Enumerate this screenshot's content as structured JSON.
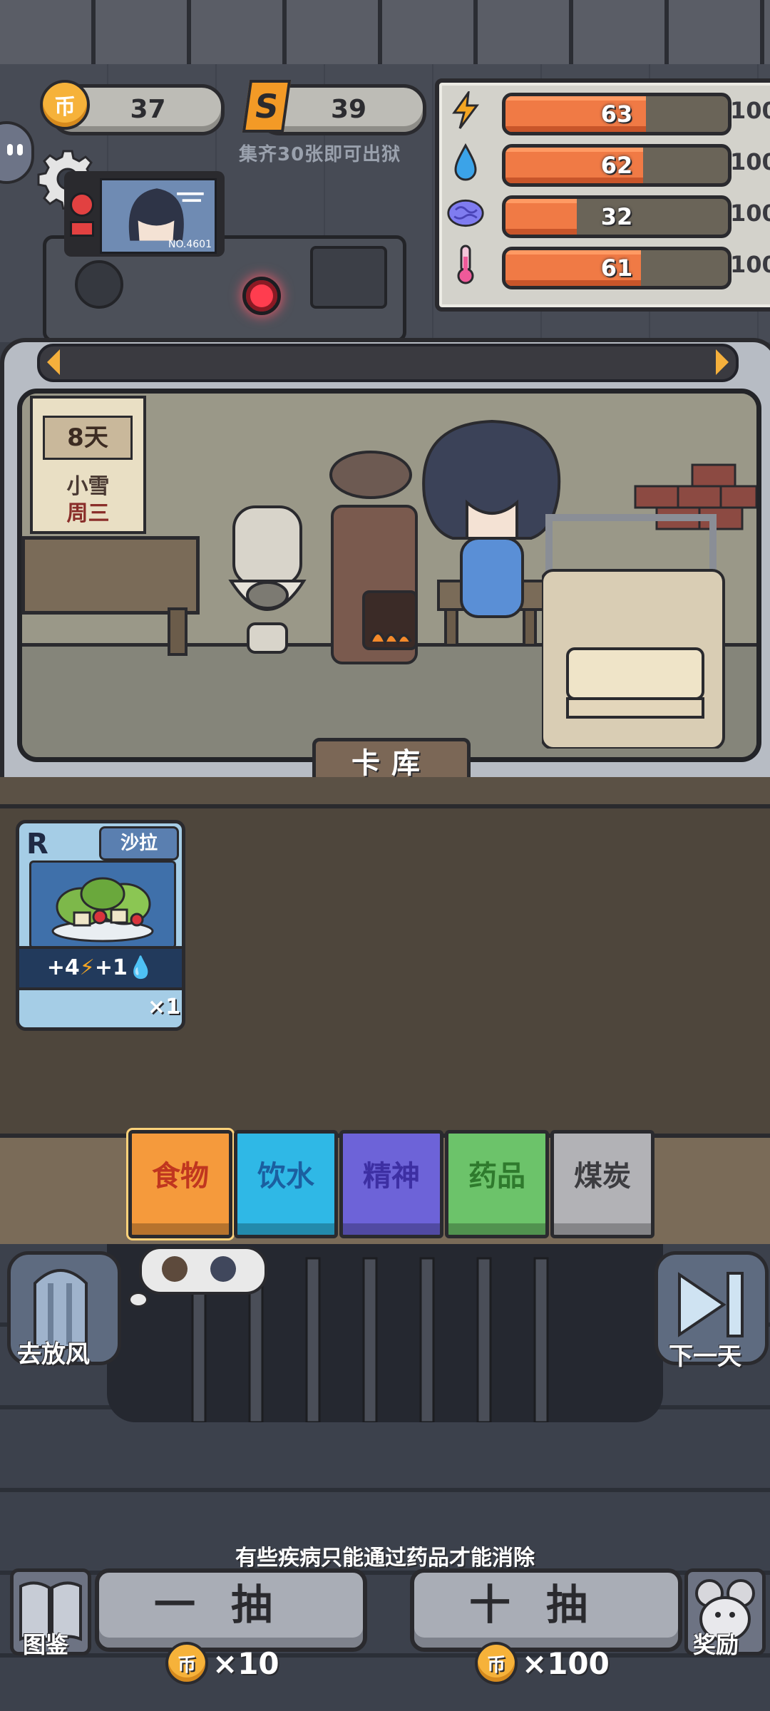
{
  "resources": {
    "coins": "37",
    "coin_symbol": "币",
    "shards": "39",
    "shard_symbol": "S",
    "collect_hint": "集齐30张即可出狱"
  },
  "monitor": {
    "label": "NO.4601"
  },
  "status": {
    "bars": [
      {
        "name": "energy",
        "icon": "lightning-icon",
        "value": "63",
        "fraction": 0.63,
        "max": "100",
        "color": "#f5a623"
      },
      {
        "name": "water",
        "icon": "water-drop-icon",
        "value": "62",
        "fraction": 0.62,
        "max": "100",
        "color": "#3ba3e8"
      },
      {
        "name": "mind",
        "icon": "brain-icon",
        "value": "32",
        "fraction": 0.32,
        "max": "100",
        "color": "#7f7cf0"
      },
      {
        "name": "temperature",
        "icon": "thermometer-icon",
        "value": "61",
        "fraction": 0.61,
        "max": "100",
        "color": "#ef5a9a"
      }
    ]
  },
  "calendar": {
    "day": "8天",
    "weather": "小雪",
    "weekday": "周三"
  },
  "scene": {
    "tab_label": "卡库"
  },
  "cards": [
    {
      "rarity": "R",
      "title": "沙拉",
      "effect": "+4⚡+1💧",
      "effect_energy": "+4",
      "effect_water": "+1",
      "count": "×1"
    }
  ],
  "categories": [
    {
      "label": "食物",
      "color": "#f59a3c",
      "text_color": "#c0361f",
      "selected": true
    },
    {
      "label": "饮水",
      "color": "#2fb8e6",
      "text_color": "#1b5fa0",
      "selected": false
    },
    {
      "label": "精神",
      "color": "#6d63d8",
      "text_color": "#3d2fa3",
      "selected": false
    },
    {
      "label": "药品",
      "color": "#6cc36a",
      "text_color": "#2f7a2d",
      "selected": false
    },
    {
      "label": "煤炭",
      "color": "#b2b2b6",
      "text_color": "#3c3c40",
      "selected": false
    }
  ],
  "actions": {
    "release_label": "去放风",
    "next_day_label": "下一天",
    "tip": "有些疾病只能通过药品才能消除",
    "draw_one_label": "一抽",
    "draw_one_cost": "×10",
    "draw_ten_label": "十抽",
    "draw_ten_cost": "×100",
    "codex_label": "图鉴",
    "reward_label": "奖励"
  }
}
